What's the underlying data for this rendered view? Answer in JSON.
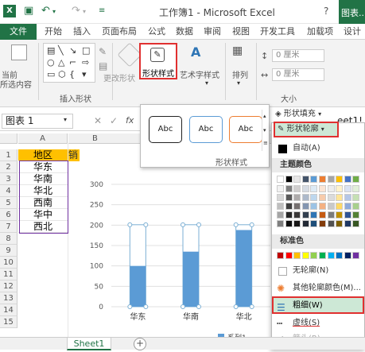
{
  "titlebar": {
    "title": "工作簿1 - Microsoft Excel",
    "help": "?",
    "chart_tools": "图表..."
  },
  "tabs": [
    "文件",
    "开始",
    "插入",
    "页面布局",
    "公式",
    "数据",
    "审阅",
    "视图",
    "开发工具",
    "加载项",
    "设计"
  ],
  "ribbon": {
    "left_label_1": "当前",
    "left_label_2": "所选内容",
    "insert_shapes_group": "插入形状",
    "change_shape": "更改形状",
    "shape_styles_button": "形状样式",
    "wordart_button": "艺术字样式",
    "arrange_button": "排列",
    "height_value": "0 厘米",
    "width_value": "0 厘米",
    "size_group": "大小"
  },
  "formula_bar": {
    "name_box": "图表 1",
    "fx": "fx",
    "formula_text": "eet1!"
  },
  "columns": [
    "A",
    "B"
  ],
  "rows": [
    "1",
    "2",
    "3",
    "4",
    "5",
    "6",
    "7",
    "8",
    "9",
    "10",
    "11",
    "12",
    "13",
    "14",
    "15"
  ],
  "cells": [
    "地区",
    "华东",
    "华南",
    "华北",
    "西南",
    "华中",
    "西北"
  ],
  "cell_b1_partial": "销",
  "chart_data": {
    "type": "bar",
    "categories": [
      "华东",
      "华南",
      "华北"
    ],
    "values": [
      100,
      135,
      188
    ],
    "ylim": [
      0,
      300
    ],
    "yticks": [
      0,
      50,
      100,
      150,
      200,
      250,
      300
    ],
    "legend": "系列1",
    "bar_color": "#5b9bd5"
  },
  "shape_styles_popup": {
    "samples": [
      "Abc",
      "Abc",
      "Abc"
    ],
    "label": "形状样式"
  },
  "shape_fill": "形状填充",
  "outline_dropdown": {
    "button": "形状轮廓",
    "auto": "自动(A)",
    "theme_colors": "主题颜色",
    "standard_colors": "标准色",
    "no_outline": "无轮廓(N)",
    "more_colors": "其他轮廓颜色(M)...",
    "weight": "粗细(W)",
    "dashes": "虚线(S)",
    "arrows": "箭头(R)"
  },
  "theme_rows": [
    [
      "#ffffff",
      "#000000",
      "#e7e6e6",
      "#44546a",
      "#5b9bd5",
      "#ed7d31",
      "#a5a5a5",
      "#ffc000",
      "#4472c4",
      "#70ad47"
    ],
    [
      "#f2f2f2",
      "#7f7f7f",
      "#d0cece",
      "#d6dce4",
      "#deebf6",
      "#fbe5d5",
      "#ededed",
      "#fff2cc",
      "#dae3f3",
      "#e2efd9"
    ],
    [
      "#d8d8d8",
      "#595959",
      "#aeabab",
      "#adb9ca",
      "#bdd7ee",
      "#f7cbac",
      "#dbdbdb",
      "#fee599",
      "#b4c6e7",
      "#c5e0b3"
    ],
    [
      "#bfbfbf",
      "#3f3f3f",
      "#757070",
      "#8496b0",
      "#9cc3e5",
      "#f4b183",
      "#c9c9c9",
      "#ffd965",
      "#8eaadb",
      "#a8d08d"
    ],
    [
      "#a5a5a5",
      "#262626",
      "#3a3838",
      "#323f4f",
      "#2e75b5",
      "#c55a11",
      "#7b7b7b",
      "#bf9000",
      "#2f5496",
      "#538135"
    ],
    [
      "#7f7f7f",
      "#0c0c0c",
      "#171616",
      "#222a35",
      "#1e4e79",
      "#833c0b",
      "#525252",
      "#7f6000",
      "#1f3864",
      "#375623"
    ]
  ],
  "standard_row": [
    "#c00000",
    "#ff0000",
    "#ffc000",
    "#ffff00",
    "#92d050",
    "#00b050",
    "#00b0f0",
    "#0070c0",
    "#002060",
    "#7030a0"
  ],
  "sheet_tab": "Sheet1",
  "add_sheet": "+"
}
